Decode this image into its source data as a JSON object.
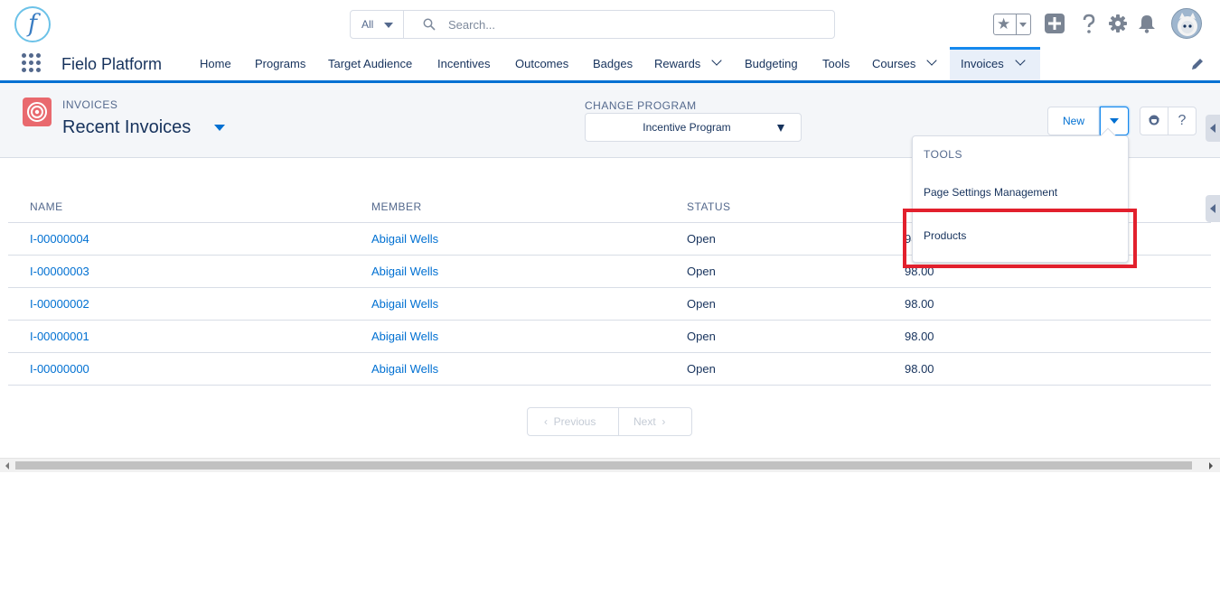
{
  "header": {
    "logo_letter": "f",
    "search": {
      "scope": "All",
      "placeholder": "Search..."
    },
    "icons": [
      "star-icon",
      "plus-icon",
      "help-icon",
      "setup-gear-icon",
      "notification-bell-icon",
      "avatar"
    ]
  },
  "nav": {
    "app_name": "Fielo Platform",
    "items": [
      {
        "label": "Home"
      },
      {
        "label": "Programs"
      },
      {
        "label": "Target Audience"
      },
      {
        "label": "Incentives"
      },
      {
        "label": "Outcomes"
      },
      {
        "label": "Badges"
      },
      {
        "label": "Rewards"
      },
      {
        "label": "Budgeting"
      },
      {
        "label": "Tools"
      },
      {
        "label": "Courses"
      },
      {
        "label": "Invoices"
      }
    ],
    "active": "Invoices"
  },
  "page": {
    "eyebrow": "INVOICES",
    "title": "Recent Invoices",
    "program": {
      "label": "CHANGE PROGRAM",
      "value": "Incentive Program"
    },
    "actions": {
      "new_label": "New",
      "help_label": "?"
    }
  },
  "table": {
    "columns": [
      "NAME",
      "MEMBER",
      "STATUS"
    ],
    "rows": [
      {
        "name": "I-00000004",
        "member": "Abigail Wells",
        "status": "Open",
        "amount": "98.00"
      },
      {
        "name": "I-00000003",
        "member": "Abigail Wells",
        "status": "Open",
        "amount": "98.00"
      },
      {
        "name": "I-00000002",
        "member": "Abigail Wells",
        "status": "Open",
        "amount": "98.00"
      },
      {
        "name": "I-00000001",
        "member": "Abigail Wells",
        "status": "Open",
        "amount": "98.00"
      },
      {
        "name": "I-00000000",
        "member": "Abigail Wells",
        "status": "Open",
        "amount": "98.00"
      }
    ]
  },
  "pagination": {
    "previous": "Previous",
    "next": "Next"
  },
  "dropdown": {
    "header": "TOOLS",
    "items": [
      {
        "label": "Page Settings Management"
      },
      {
        "label": "Products"
      }
    ],
    "highlighted": "Products"
  },
  "colors": {
    "brand": "#0070d2",
    "highlight": "#e2202d",
    "object_icon": "#e9696e"
  }
}
